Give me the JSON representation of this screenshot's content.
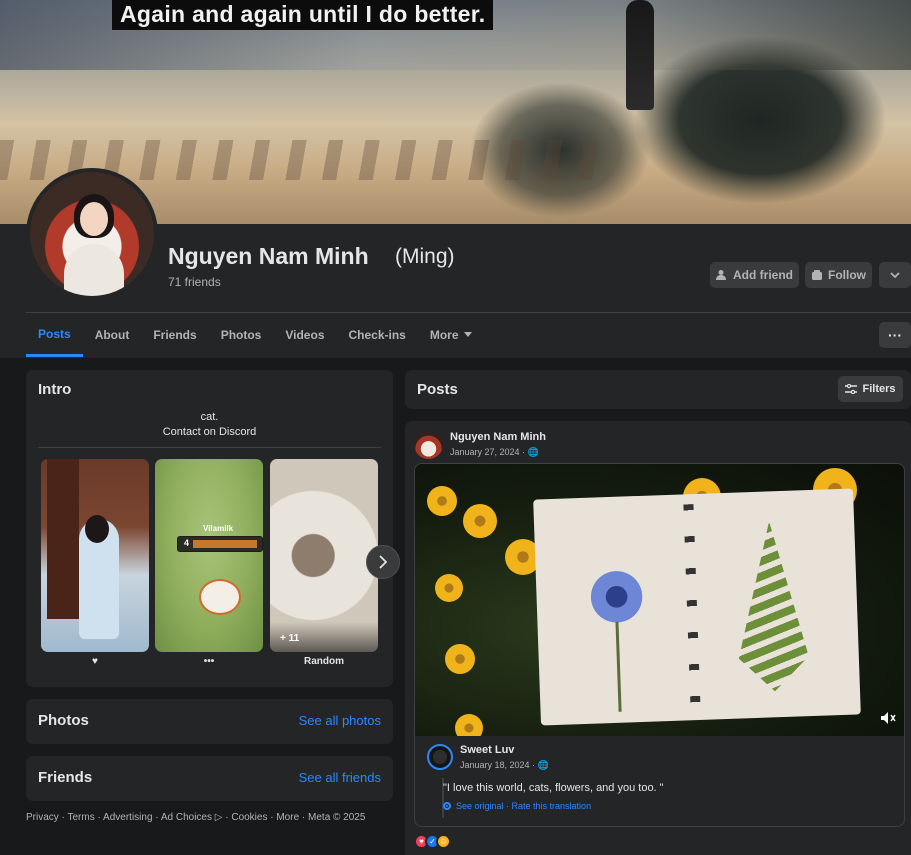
{
  "cover": {
    "caption": "Again and again until I do better."
  },
  "profile": {
    "name": "Nguyen Nam Minh",
    "alt_name": "(Ming)",
    "friends_count": "71 friends",
    "actions": {
      "add_friend": "Add friend",
      "follow": "Follow"
    }
  },
  "tabs": [
    {
      "label": "Posts",
      "active": true
    },
    {
      "label": "About"
    },
    {
      "label": "Friends"
    },
    {
      "label": "Photos"
    },
    {
      "label": "Videos"
    },
    {
      "label": "Check-ins"
    },
    {
      "label": "More"
    }
  ],
  "more_menu_label": "···",
  "intro": {
    "title": "Intro",
    "bio_line1": "cat.",
    "bio_line2": "Contact on Discord",
    "featured": [
      {
        "caption": "♥"
      },
      {
        "caption": "•••",
        "game_level": "4",
        "game_name": "Vilamilk"
      },
      {
        "caption": "Random",
        "extra_count": "+ 11"
      }
    ]
  },
  "photos": {
    "title": "Photos",
    "see_all": "See all photos"
  },
  "friends": {
    "title": "Friends",
    "see_all": "See all friends"
  },
  "footer": "Privacy · Terms · Advertising · Ad Choices ▷ · Cookies · More · Meta © 2025",
  "posts": {
    "title": "Posts",
    "filters_label": "Filters",
    "post": {
      "author": "Nguyen Nam Minh",
      "date": "January 27, 2024 · 🌐",
      "shared": {
        "author": "Sweet Luv",
        "date": "January 18, 2024 · 🌐",
        "text": "\"I love this world, cats, flowers, and you too. \"",
        "translate_links": "See original · Rate this translation"
      }
    }
  },
  "colors": {
    "accent": "#2d88ff",
    "card": "#242526",
    "bg": "#18191a"
  }
}
